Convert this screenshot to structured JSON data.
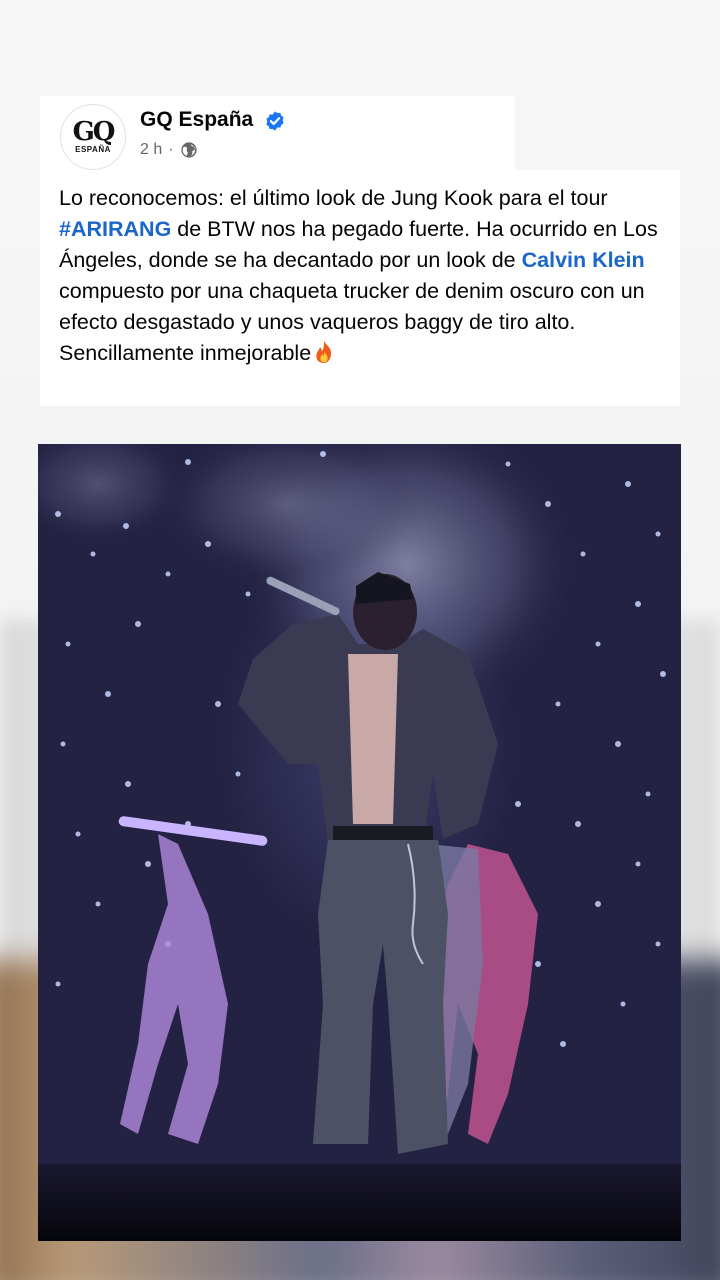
{
  "post": {
    "author": "GQ España",
    "avatar_text": "GQ",
    "avatar_subtext": "ESPAÑA",
    "time": "2 h",
    "separator": "·",
    "audience_icon": "globe-icon",
    "verified_icon": "verified-badge-icon",
    "caption": {
      "part1": "Lo reconocemos: el último look de Jung Kook para el tour ",
      "hashtag": "#ARIRANG",
      "part2": " de BTW nos ha pegado fuerte. Ha ocurrido en Los Ángeles, donde se ha decantado por un look de ",
      "mention": "Calvin Klein",
      "part3": " compuesto por una chaqueta trucker de denim oscuro con un efecto desgastado y unos vaqueros baggy de tiro alto. Sencillamente inmejorable",
      "emoji_icon": "fire-icon"
    },
    "photo_icon": "concert-photo"
  },
  "colors": {
    "link": "#1b66c9",
    "verified": "#1877f2",
    "meta": "#65676b"
  }
}
